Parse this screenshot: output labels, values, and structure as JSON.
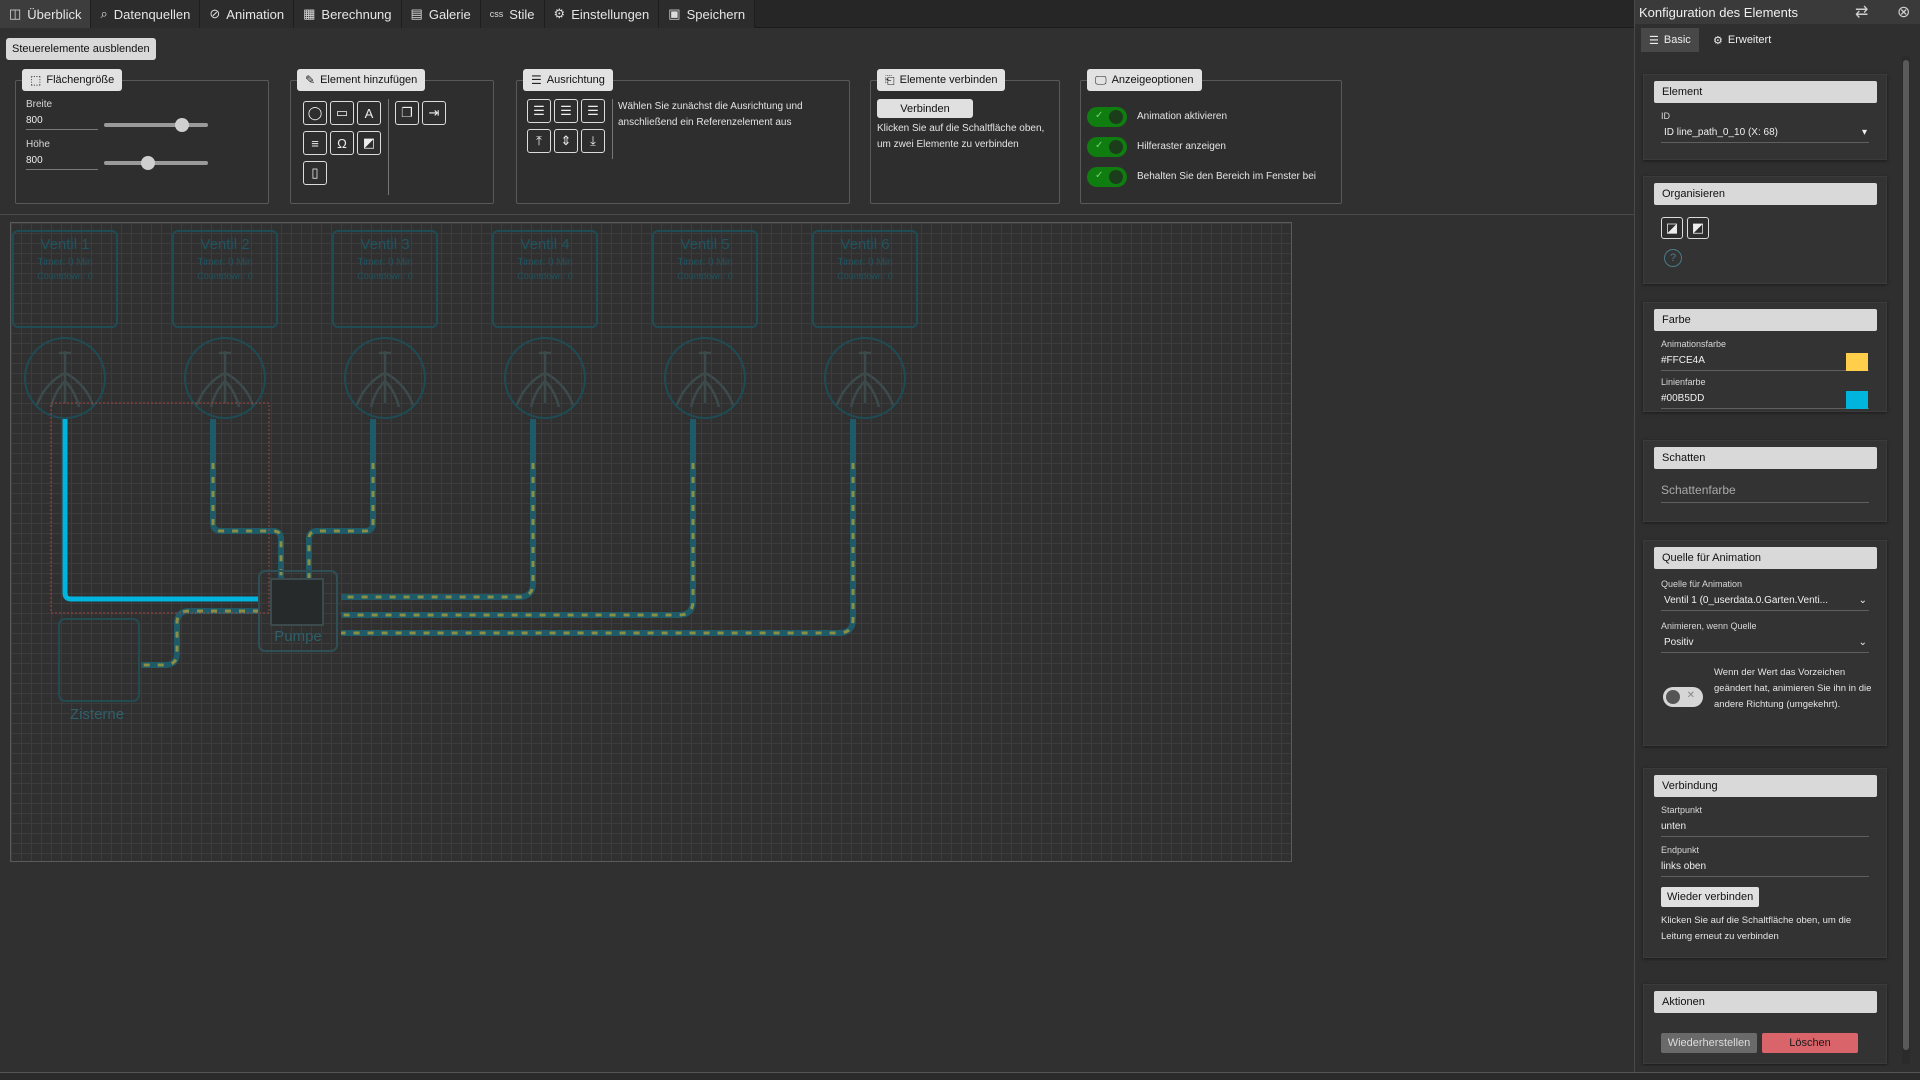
{
  "menu": {
    "tabs": [
      {
        "label": "Überblick",
        "icon": "layout-icon"
      },
      {
        "label": "Datenquellen",
        "icon": "search-data-icon"
      },
      {
        "label": "Animation",
        "icon": "animation-icon"
      },
      {
        "label": "Berechnung",
        "icon": "calculator-icon"
      },
      {
        "label": "Galerie",
        "icon": "gallery-icon"
      },
      {
        "label": "Stile",
        "icon": "css-icon",
        "icon_text": "css"
      },
      {
        "label": "Einstellungen",
        "icon": "gear-icon"
      },
      {
        "label": "Speichern",
        "icon": "save-icon"
      }
    ]
  },
  "hide_controls_label": "Steuerelemente ausblenden",
  "toolbar": {
    "surface": {
      "title": "Flächengröße",
      "width_label": "Breite",
      "width_value": "800",
      "width_slider": 0.75,
      "height_label": "Höhe",
      "height_value": "800",
      "height_slider": 0.42
    },
    "add_element": {
      "title": "Element hinzufügen"
    },
    "alignment": {
      "title": "Ausrichtung",
      "hint": "Wählen Sie zunächst die Ausrichtung und anschließend ein Referenzelement aus"
    },
    "connect": {
      "title": "Elemente verbinden",
      "button": "Verbinden",
      "hint": "Klicken Sie auf die Schaltfläche oben, um zwei Elemente zu verbinden"
    },
    "display": {
      "title": "Anzeigeoptionen",
      "options": [
        {
          "label": "Animation aktivieren",
          "on": true
        },
        {
          "label": "Hilferaster anzeigen",
          "on": true
        },
        {
          "label": "Behalten Sie den Bereich im Fenster bei",
          "on": true
        }
      ]
    }
  },
  "canvas": {
    "valves": [
      {
        "name": "Ventil 1",
        "timer": "Timer: 0 Min",
        "countdown": "Countdown: 0"
      },
      {
        "name": "Ventil 2",
        "timer": "Timer: 0 Min",
        "countdown": "Countdown: 0"
      },
      {
        "name": "Ventil 3",
        "timer": "Timer: 0 Min",
        "countdown": "Countdown: 0"
      },
      {
        "name": "Ventil 4",
        "timer": "Timer: 0 Min",
        "countdown": "Countdown: 0"
      },
      {
        "name": "Ventil 5",
        "timer": "Timer: 0 Min",
        "countdown": "Countdown: 0"
      },
      {
        "name": "Ventil 6",
        "timer": "Timer: 0 Min",
        "countdown": "Countdown: 0"
      }
    ],
    "pump_label": "Pumpe",
    "cistern_label": "Zisterne",
    "pipe_color": "#1e5a68",
    "active_line_color": "#00B5DD",
    "animation_color": "#FFCE4A"
  },
  "panel": {
    "title": "Konfiguration des Elements",
    "tabs": [
      {
        "label": "Basic"
      },
      {
        "label": "Erweitert"
      }
    ],
    "element": {
      "header": "Element",
      "id_label": "ID",
      "id_value": "ID line_path_0_10 (X: 68)"
    },
    "organize": {
      "header": "Organisieren"
    },
    "color": {
      "header": "Farbe",
      "anim_label": "Animationsfarbe",
      "anim_value": "#FFCE4A",
      "line_label": "Linienfarbe",
      "line_value": "#00B5DD"
    },
    "shadow": {
      "header": "Schatten",
      "placeholder": "Schattenfarbe"
    },
    "anim_source": {
      "header": "Quelle für Animation",
      "source_label": "Quelle für Animation",
      "source_value": "Ventil 1 (0_userdata.0.Garten.Venti...",
      "when_label": "Animieren, wenn Quelle",
      "when_value": "Positiv",
      "reverse_text": "Wenn der Wert das Vorzeichen geändert hat, animieren Sie ihn in die andere Richtung (umgekehrt).",
      "reverse_on": false
    },
    "connection": {
      "header": "Verbindung",
      "start_label": "Startpunkt",
      "start_value": "unten",
      "end_label": "Endpunkt",
      "end_value": "links oben",
      "reconnect_button": "Wieder verbinden",
      "reconnect_hint": "Klicken Sie auf die Schaltfläche oben, um die Leitung erneut zu verbinden"
    },
    "actions": {
      "header": "Aktionen",
      "restore": "Wiederherstellen",
      "delete": "Löschen"
    }
  }
}
